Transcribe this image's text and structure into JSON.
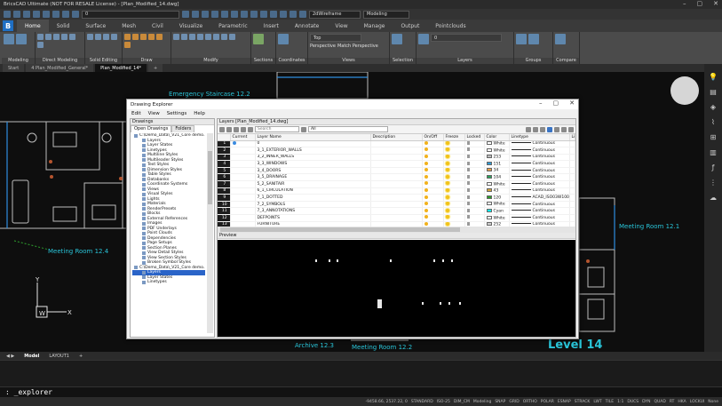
{
  "titlebar": {
    "title": "BricsCAD Ultimate (NOT FOR RESALE License) - [Plan_Modified_14.dwg]"
  },
  "quickbar": {
    "layer_value": "0",
    "visual_style": "2dWireframe",
    "workspace": "Modeling"
  },
  "ribbon": {
    "tabs": [
      "Home",
      "Solid",
      "Surface",
      "Mesh",
      "Civil",
      "Visualize",
      "Parametric",
      "Insert",
      "Annotate",
      "View",
      "Manage",
      "Output",
      "Pointclouds"
    ],
    "active_tab": "Home",
    "panels": [
      {
        "id": "modeling",
        "label": "Modeling",
        "icons": [
          "Box",
          "Extrude",
          "Solid"
        ]
      },
      {
        "id": "direct",
        "label": "Direct Modeling",
        "icons": []
      },
      {
        "id": "solidedit",
        "label": "Solid Editing",
        "icons": []
      },
      {
        "id": "draw",
        "label": "Draw",
        "icons": []
      },
      {
        "id": "modify",
        "label": "Modify",
        "icons": [
          "Copy Guided"
        ]
      },
      {
        "id": "sections",
        "label": "Sections",
        "icons": [
          "Section Plane"
        ]
      },
      {
        "id": "coords",
        "label": "Coordinates",
        "icons": [
          "UCS..."
        ]
      },
      {
        "id": "views",
        "label": "Views",
        "icons": [
          "Top",
          "Perspective",
          "Match Perspective"
        ]
      },
      {
        "id": "selection",
        "label": "Selection",
        "icons": [
          "Manipulate"
        ]
      },
      {
        "id": "layers",
        "label": "Layers",
        "icons": [
          "Layers"
        ]
      },
      {
        "id": "groups",
        "label": "Groups",
        "icons": [
          "Group",
          "Ungroup"
        ]
      },
      {
        "id": "compare",
        "label": "Compare",
        "icons": [
          "Dwg Compare"
        ]
      }
    ],
    "layer_combo": "0"
  },
  "doctabs": [
    {
      "label": "Start",
      "active": false
    },
    {
      "label": "4 Plan_Modified_General*",
      "active": false
    },
    {
      "label": "Plan_Modified_14*",
      "active": true
    }
  ],
  "canvas": {
    "labels": [
      {
        "id": "emergency-staircase",
        "text": "Emergency Staircase 12.2"
      },
      {
        "id": "meeting-room-124",
        "text": "Meeting Room 12.4"
      },
      {
        "id": "meeting-room-121",
        "text": "Meeting Room 12.1"
      },
      {
        "id": "meeting-room-122",
        "text": "Meeting Room 12.2"
      },
      {
        "id": "archive",
        "text": "Archive 12.3"
      },
      {
        "id": "level",
        "text": "Level 14"
      }
    ],
    "ucs": {
      "x": "X",
      "y": "Y",
      "w": "W"
    }
  },
  "dialog": {
    "title": "Drawing Explorer",
    "menu": [
      "Edit",
      "View",
      "Settings",
      "Help"
    ],
    "left_header": "Drawings",
    "left_tabs": [
      "Open Drawings",
      "Folders"
    ],
    "tree": [
      {
        "label": "C:\\Demo_Data\\_V21_Core demo...",
        "level": 0
      },
      {
        "label": "Layers",
        "level": 1
      },
      {
        "label": "Layer States",
        "level": 1
      },
      {
        "label": "Linetypes",
        "level": 1
      },
      {
        "label": "Multiline Styles",
        "level": 1
      },
      {
        "label": "Multileader Styles",
        "level": 1
      },
      {
        "label": "Text Styles",
        "level": 1
      },
      {
        "label": "Dimension Styles",
        "level": 1
      },
      {
        "label": "Table Styles",
        "level": 1
      },
      {
        "label": "Databanks",
        "level": 1
      },
      {
        "label": "Coordinate Systems",
        "level": 1
      },
      {
        "label": "Views",
        "level": 1
      },
      {
        "label": "Visual Styles",
        "level": 1
      },
      {
        "label": "Lights",
        "level": 1
      },
      {
        "label": "Materials",
        "level": 1
      },
      {
        "label": "RenderPresets",
        "level": 1
      },
      {
        "label": "Blocks",
        "level": 1
      },
      {
        "label": "External References",
        "level": 1
      },
      {
        "label": "Images",
        "level": 1
      },
      {
        "label": "PDF Underlays",
        "level": 1
      },
      {
        "label": "Point Clouds",
        "level": 1
      },
      {
        "label": "Dependencies",
        "level": 1
      },
      {
        "label": "Page Setups",
        "level": 1
      },
      {
        "label": "Section Planes",
        "level": 1
      },
      {
        "label": "View Detail Styles",
        "level": 1
      },
      {
        "label": "View Section Styles",
        "level": 1
      },
      {
        "label": "Broken Symbol Styles",
        "level": 1
      },
      {
        "label": "C:\\Demo_Data\\_V21_Core demo...",
        "level": 0
      },
      {
        "label": "Layers",
        "level": 1,
        "selected": true
      },
      {
        "label": "Layer States",
        "level": 1
      },
      {
        "label": "Linetypes",
        "level": 1
      }
    ],
    "right_header": "Layers [Plan_Modified_14.dwg]",
    "search_placeholder": "Search",
    "filter_value": "All",
    "columns": [
      "",
      "Current",
      "Layer Name",
      "Description",
      "On/Off",
      "Freeze",
      "Locked",
      "Color",
      "Linetype",
      "Lin"
    ],
    "rows": [
      {
        "n": "1",
        "name": "0",
        "color": "White",
        "swatch": "#ffffff",
        "lt": "Continuous",
        "current": true
      },
      {
        "n": "2",
        "name": "3_1_EXTERIOR_WALLS",
        "color": "White",
        "swatch": "#ffffff",
        "lt": "Continuous"
      },
      {
        "n": "3",
        "name": "3_2_INNER_WALLS",
        "color": "253",
        "swatch": "#bdbdbd",
        "lt": "Continuous"
      },
      {
        "n": "4",
        "name": "3_3_WINDOWS",
        "color": "151",
        "swatch": "#2e9ad6",
        "lt": "Continuous"
      },
      {
        "n": "5",
        "name": "3_4_DOORS",
        "color": "34",
        "swatch": "#e8a04a",
        "lt": "Continuous"
      },
      {
        "n": "6",
        "name": "3_5_DRAINAGE",
        "color": "104",
        "swatch": "#2aa25b",
        "lt": "Continuous"
      },
      {
        "n": "7",
        "name": "5_2_SANITAIR",
        "color": "White",
        "swatch": "#ffffff",
        "lt": "Continuous"
      },
      {
        "n": "8",
        "name": "6_1_CIRCULATION",
        "color": "43",
        "swatch": "#d6a63a",
        "lt": "Continuous"
      },
      {
        "n": "9",
        "name": "7_1_DOTTED",
        "color": "120",
        "swatch": "#2a9c2a",
        "lt": "ACAD_ISO03W100"
      },
      {
        "n": "10",
        "name": "7_2_SYMBOLS",
        "color": "White",
        "swatch": "#ffffff",
        "lt": "Continuous"
      },
      {
        "n": "11",
        "name": "7_3_ANNOTATIONS",
        "color": "Cyan",
        "swatch": "#00ffff",
        "lt": "Continuous"
      },
      {
        "n": "12",
        "name": "DEFPOINTS",
        "color": "White",
        "swatch": "#ffffff",
        "lt": "Continuous"
      },
      {
        "n": "13",
        "name": "FURNITURE",
        "color": "252",
        "swatch": "#cfcfcf",
        "lt": "Continuous"
      }
    ],
    "preview_header": "Preview"
  },
  "layout_tabs": [
    {
      "label": "Model",
      "active": true
    },
    {
      "label": "LAYOUT1",
      "active": false
    }
  ],
  "command": {
    "text": ": _explorer"
  },
  "status": {
    "coords": "-9458.66, 2537.22, 0",
    "items": [
      "STANDARD",
      "ISO-25",
      "DIM_CM",
      "Modeling",
      "SNAP",
      "GRID",
      "ORTHO",
      "POLAR",
      "ESNAP",
      "STRACK",
      "LWT",
      "TILE",
      "1:1",
      "DUCS",
      "DYN",
      "QUAD",
      "RT",
      "HKA",
      "LOCKUI",
      "None"
    ]
  },
  "colors": {
    "accent": "#1f6fc4",
    "cad_label": "#29c4d8",
    "selection": "#2a64c8"
  }
}
